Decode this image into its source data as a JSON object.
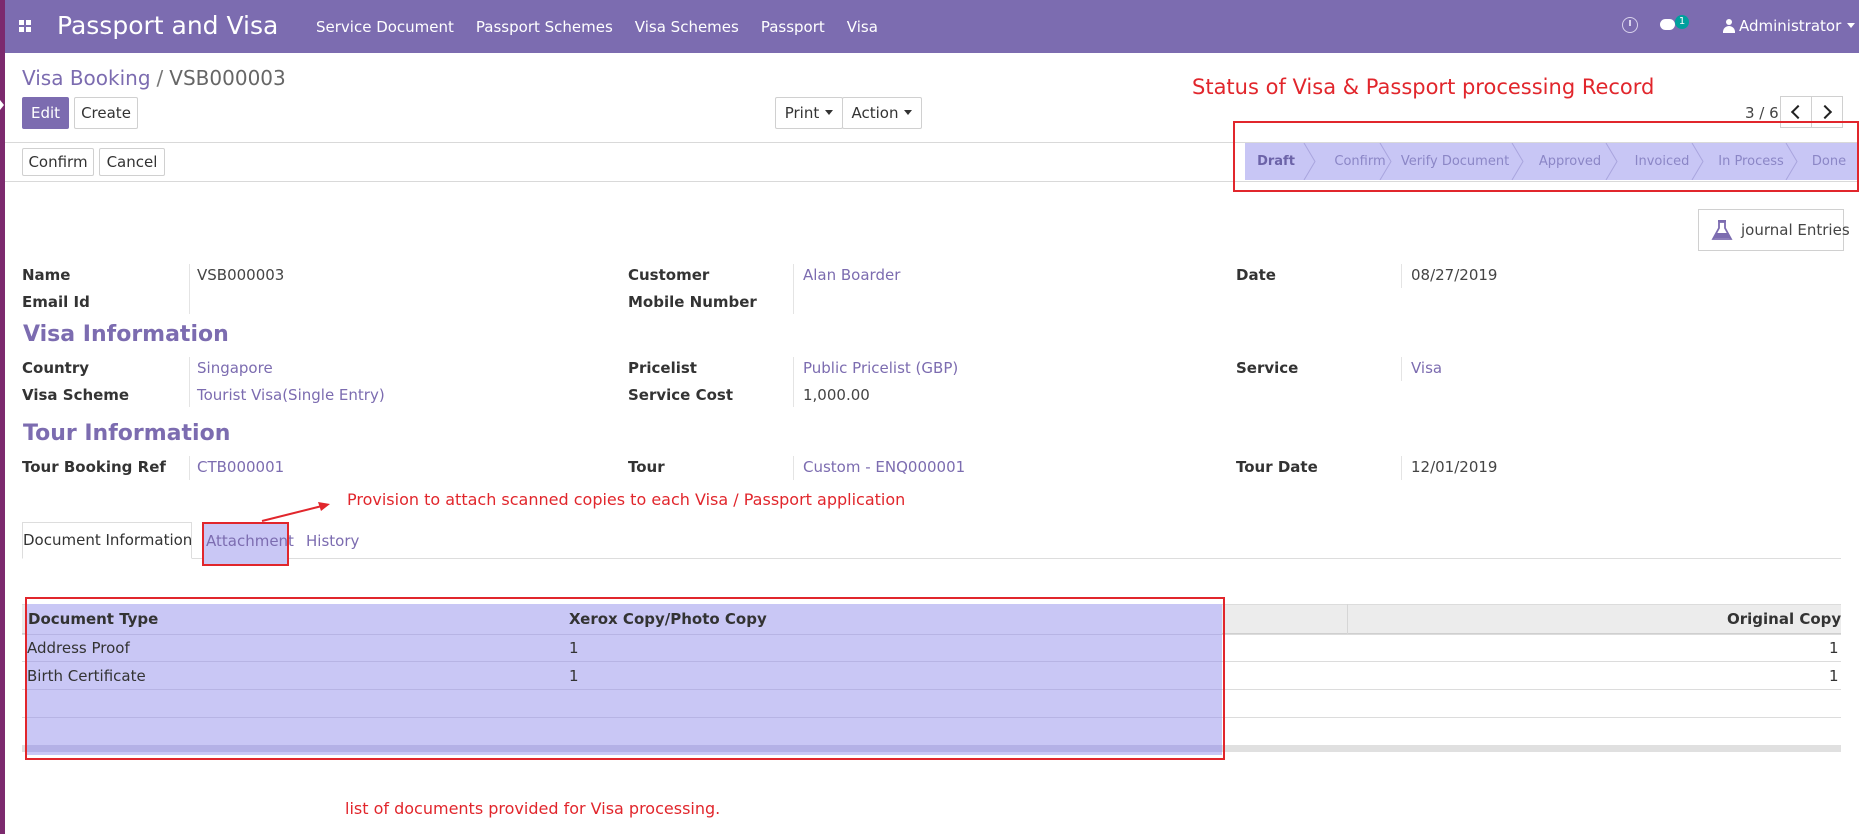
{
  "navbar": {
    "app_title": "Passport and Visa",
    "menu": [
      "Service Document",
      "Passport Schemes",
      "Visa Schemes",
      "Passport",
      "Visa"
    ],
    "messages_count": "1",
    "user": "Administrator",
    "color": "#7c6cb0"
  },
  "breadcrumb": {
    "parent": "Visa Booking",
    "separator": "/",
    "current": "VSB000003"
  },
  "buttons": {
    "edit": "Edit",
    "create": "Create",
    "print": "Print",
    "action": "Action",
    "confirm": "Confirm",
    "cancel": "Cancel"
  },
  "pager": {
    "text": "3 / 6"
  },
  "statusbar": {
    "stages": [
      "Draft",
      "Confirm",
      "Verify Document",
      "Approved",
      "Invoiced",
      "In Process",
      "Done"
    ],
    "active": "Draft"
  },
  "annotations": {
    "status": "Status of Visa & Passport processing Record",
    "attach": "Provision to attach scanned copies to each Visa / Passport application",
    "list": "list of documents provided for Visa processing.",
    "color": "#e1262c"
  },
  "smart_button": {
    "label": "journal Entries",
    "icon": "flask-icon"
  },
  "form": {
    "name_label": "Name",
    "name": "VSB000003",
    "email_label": "Email Id",
    "email": "",
    "customer_label": "Customer",
    "customer": "Alan Boarder",
    "mobile_label": "Mobile Number",
    "mobile": "",
    "date_label": "Date",
    "date": "08/27/2019",
    "visa_section": "Visa Information",
    "country_label": "Country",
    "country": "Singapore",
    "scheme_label": "Visa Scheme",
    "scheme": "Tourist Visa(Single Entry)",
    "pricelist_label": "Pricelist",
    "pricelist": "Public Pricelist (GBP)",
    "cost_label": "Service Cost",
    "cost": "1,000.00",
    "service_label": "Service",
    "service": "Visa",
    "tour_section": "Tour Information",
    "tour_ref_label": "Tour Booking Ref",
    "tour_ref": "CTB000001",
    "tour_label": "Tour",
    "tour": "Custom - ENQ000001",
    "tour_date_label": "Tour Date",
    "tour_date": "12/01/2019"
  },
  "tabs": [
    "Document Information",
    "Attachment",
    "History"
  ],
  "table": {
    "headers": [
      "Document Type",
      "Xerox Copy/Photo Copy",
      "Original Copy"
    ],
    "rows": [
      [
        "Address Proof",
        "1",
        "1"
      ],
      [
        "Birth Certificate",
        "1",
        "1"
      ]
    ]
  }
}
